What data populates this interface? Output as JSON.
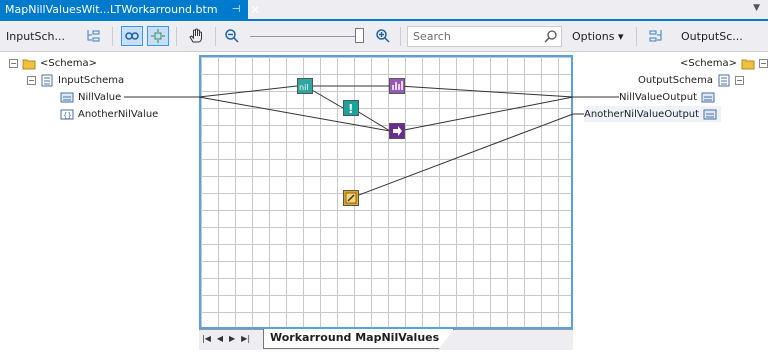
{
  "document_tab": {
    "title": "MapNillValuesWit...LTWorkarround.btm",
    "pin_icon": "pin-icon",
    "close_label": "✕"
  },
  "toolbar": {
    "input_schema_label": "InputSch...",
    "search_placeholder": "Search",
    "options_label": "Options ▾",
    "output_schema_label": "OutputSc..."
  },
  "source_tree": {
    "root": "<Schema>",
    "schema": "InputSchema",
    "fields": [
      "NillValue",
      "AnotherNilValue"
    ]
  },
  "destination_tree": {
    "root": "<Schema>",
    "schema": "OutputSchema",
    "fields": [
      "NillValueOutput",
      "AnotherNilValueOutput"
    ]
  },
  "grid_page": {
    "tab_label": "Workarround MapNilValues"
  },
  "colors": {
    "accent": "#007acc",
    "grid_border": "#5aa0e6"
  }
}
